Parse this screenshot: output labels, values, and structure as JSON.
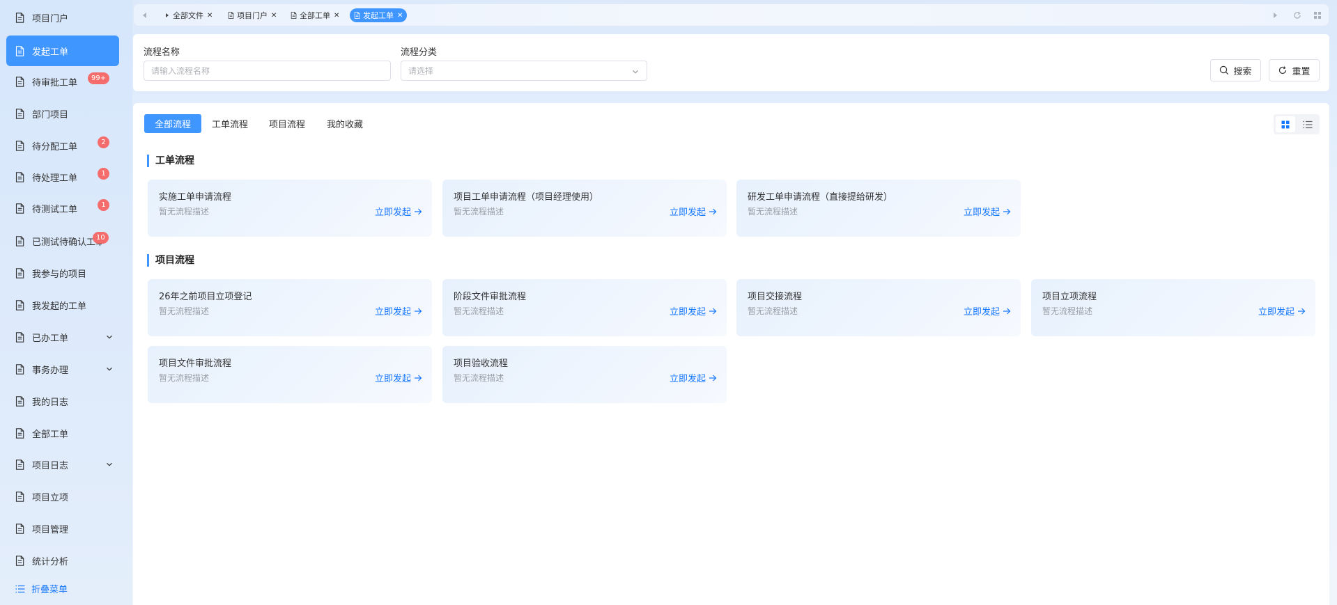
{
  "sidebar": {
    "items": [
      {
        "label": "项目门户",
        "active": false
      },
      {
        "label": "发起工单",
        "active": true
      },
      {
        "label": "待审批工单",
        "badge": "99+"
      },
      {
        "label": "部门项目"
      },
      {
        "label": "待分配工单",
        "badge": "2"
      },
      {
        "label": "待处理工单",
        "badge": "1"
      },
      {
        "label": "待测试工单",
        "badge": "1"
      },
      {
        "label": "已测试待确认工单",
        "badge": "10"
      },
      {
        "label": "我参与的项目"
      },
      {
        "label": "我发起的工单"
      },
      {
        "label": "已办工单",
        "expandable": true
      },
      {
        "label": "事务办理",
        "expandable": true
      },
      {
        "label": "我的日志"
      },
      {
        "label": "全部工单"
      },
      {
        "label": "项目日志",
        "expandable": true
      },
      {
        "label": "项目立项"
      },
      {
        "label": "项目管理"
      },
      {
        "label": "统计分析"
      }
    ],
    "collapse_label": "折叠菜单"
  },
  "tabs": [
    {
      "label": "全部文件"
    },
    {
      "label": "项目门户"
    },
    {
      "label": "全部工单"
    },
    {
      "label": "发起工单",
      "active": true
    }
  ],
  "search": {
    "name_label": "流程名称",
    "name_placeholder": "请输入流程名称",
    "category_label": "流程分类",
    "category_placeholder": "请选择",
    "search_button": "搜索",
    "reset_button": "重置"
  },
  "filter_tabs": [
    {
      "label": "全部流程",
      "active": true
    },
    {
      "label": "工单流程"
    },
    {
      "label": "项目流程"
    },
    {
      "label": "我的收藏"
    }
  ],
  "sections": [
    {
      "title": "工单流程",
      "cards": [
        {
          "title": "实施工单申请流程",
          "desc": "暂无流程描述",
          "action": "立即发起"
        },
        {
          "title": "项目工单申请流程（项目经理使用）",
          "desc": "暂无流程描述",
          "action": "立即发起"
        },
        {
          "title": "研发工单申请流程（直接提给研发）",
          "desc": "暂无流程描述",
          "action": "立即发起"
        }
      ]
    },
    {
      "title": "项目流程",
      "cards": [
        {
          "title": "26年之前项目立项登记",
          "desc": "暂无流程描述",
          "action": "立即发起"
        },
        {
          "title": "阶段文件审批流程",
          "desc": "暂无流程描述",
          "action": "立即发起"
        },
        {
          "title": "项目交接流程",
          "desc": "暂无流程描述",
          "action": "立即发起"
        },
        {
          "title": "项目立项流程",
          "desc": "暂无流程描述",
          "action": "立即发起"
        },
        {
          "title": "项目文件审批流程",
          "desc": "暂无流程描述",
          "action": "立即发起"
        },
        {
          "title": "项目验收流程",
          "desc": "暂无流程描述",
          "action": "立即发起"
        }
      ]
    }
  ],
  "colors": {
    "accent": "#4096ff",
    "badge": "#f56c6c",
    "link": "#1677ff"
  }
}
